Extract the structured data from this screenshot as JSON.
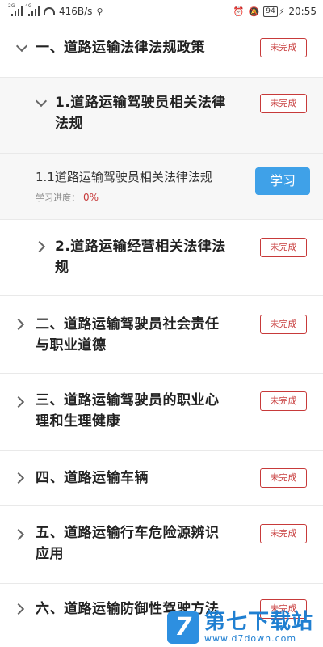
{
  "status_bar": {
    "network_left": "2G",
    "network_right": "4G",
    "speed": "416B/s",
    "battery": "94",
    "time": "20:55"
  },
  "sections": [
    {
      "title_line1": "一、道路运输法律法规政策",
      "title_line2": "",
      "status": "未完成"
    },
    {
      "title_line1": "1.道路运输驾驶员相关法律",
      "title_line2": "法规",
      "status": "未完成"
    },
    {
      "title_line1": "2.道路运输经营相关法律法",
      "title_line2": "规",
      "status": "未完成"
    },
    {
      "title_line1": "二、道路运输驾驶员社会责任",
      "title_line2": "与职业道德",
      "status": "未完成"
    },
    {
      "title_line1": "三、道路运输驾驶员的职业心",
      "title_line2": "理和生理健康",
      "status": "未完成"
    },
    {
      "title_line1": "四、道路运输车辆",
      "title_line2": "",
      "status": "未完成"
    },
    {
      "title_line1": "五、道路运输行车危险源辨识",
      "title_line2": "应用",
      "status": "未完成"
    },
    {
      "title_line1": "六、道路运输防御性驾驶方法",
      "title_line2": "",
      "status": "未完成"
    }
  ],
  "lesson": {
    "title": "1.1道路运输驾驶员相关法律法规",
    "progress_label": "学习进度：",
    "progress_value": "0%",
    "study_button": "学习"
  },
  "watermark": {
    "logo_char": "7",
    "text": "第七下载站",
    "url": "www.d7down.com"
  }
}
